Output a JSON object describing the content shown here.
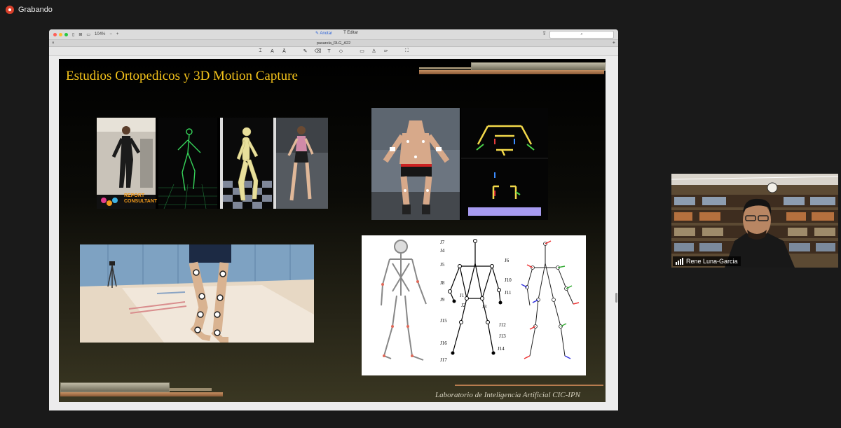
{
  "recording": {
    "label": "Grabando",
    "color": "#d9402b"
  },
  "viewer": {
    "zoom": "104%",
    "mode_annotate": "Anotar",
    "mode_edit": "Editar",
    "tab_title": "pasarela_RLG_A22",
    "annotation_tools": [
      "select-text-icon",
      "text-icon",
      "highlight-icon",
      "pen-icon",
      "eraser-icon",
      "text-box-icon",
      "shapes-icon",
      "note-icon",
      "signature-icon",
      "pointer-icon",
      "crop-icon"
    ]
  },
  "slide": {
    "title": "Estudios Ortopedicos y 3D Motion Capture",
    "footer": "Laboratorio de Inteligencia Artificial  CIC-IPN",
    "title_color": "#f3c21b",
    "logo_text": [
      "REPORT",
      "CONSULTANT"
    ],
    "joint_labels": [
      "J7",
      "J4",
      "J5",
      "J6",
      "J8",
      "J10",
      "J11",
      "J1",
      "J2",
      "J3",
      "J9",
      "J15",
      "J12",
      "J13",
      "J16",
      "J14",
      "J17"
    ]
  },
  "participant": {
    "name": "Rene Luna-Garcia"
  }
}
